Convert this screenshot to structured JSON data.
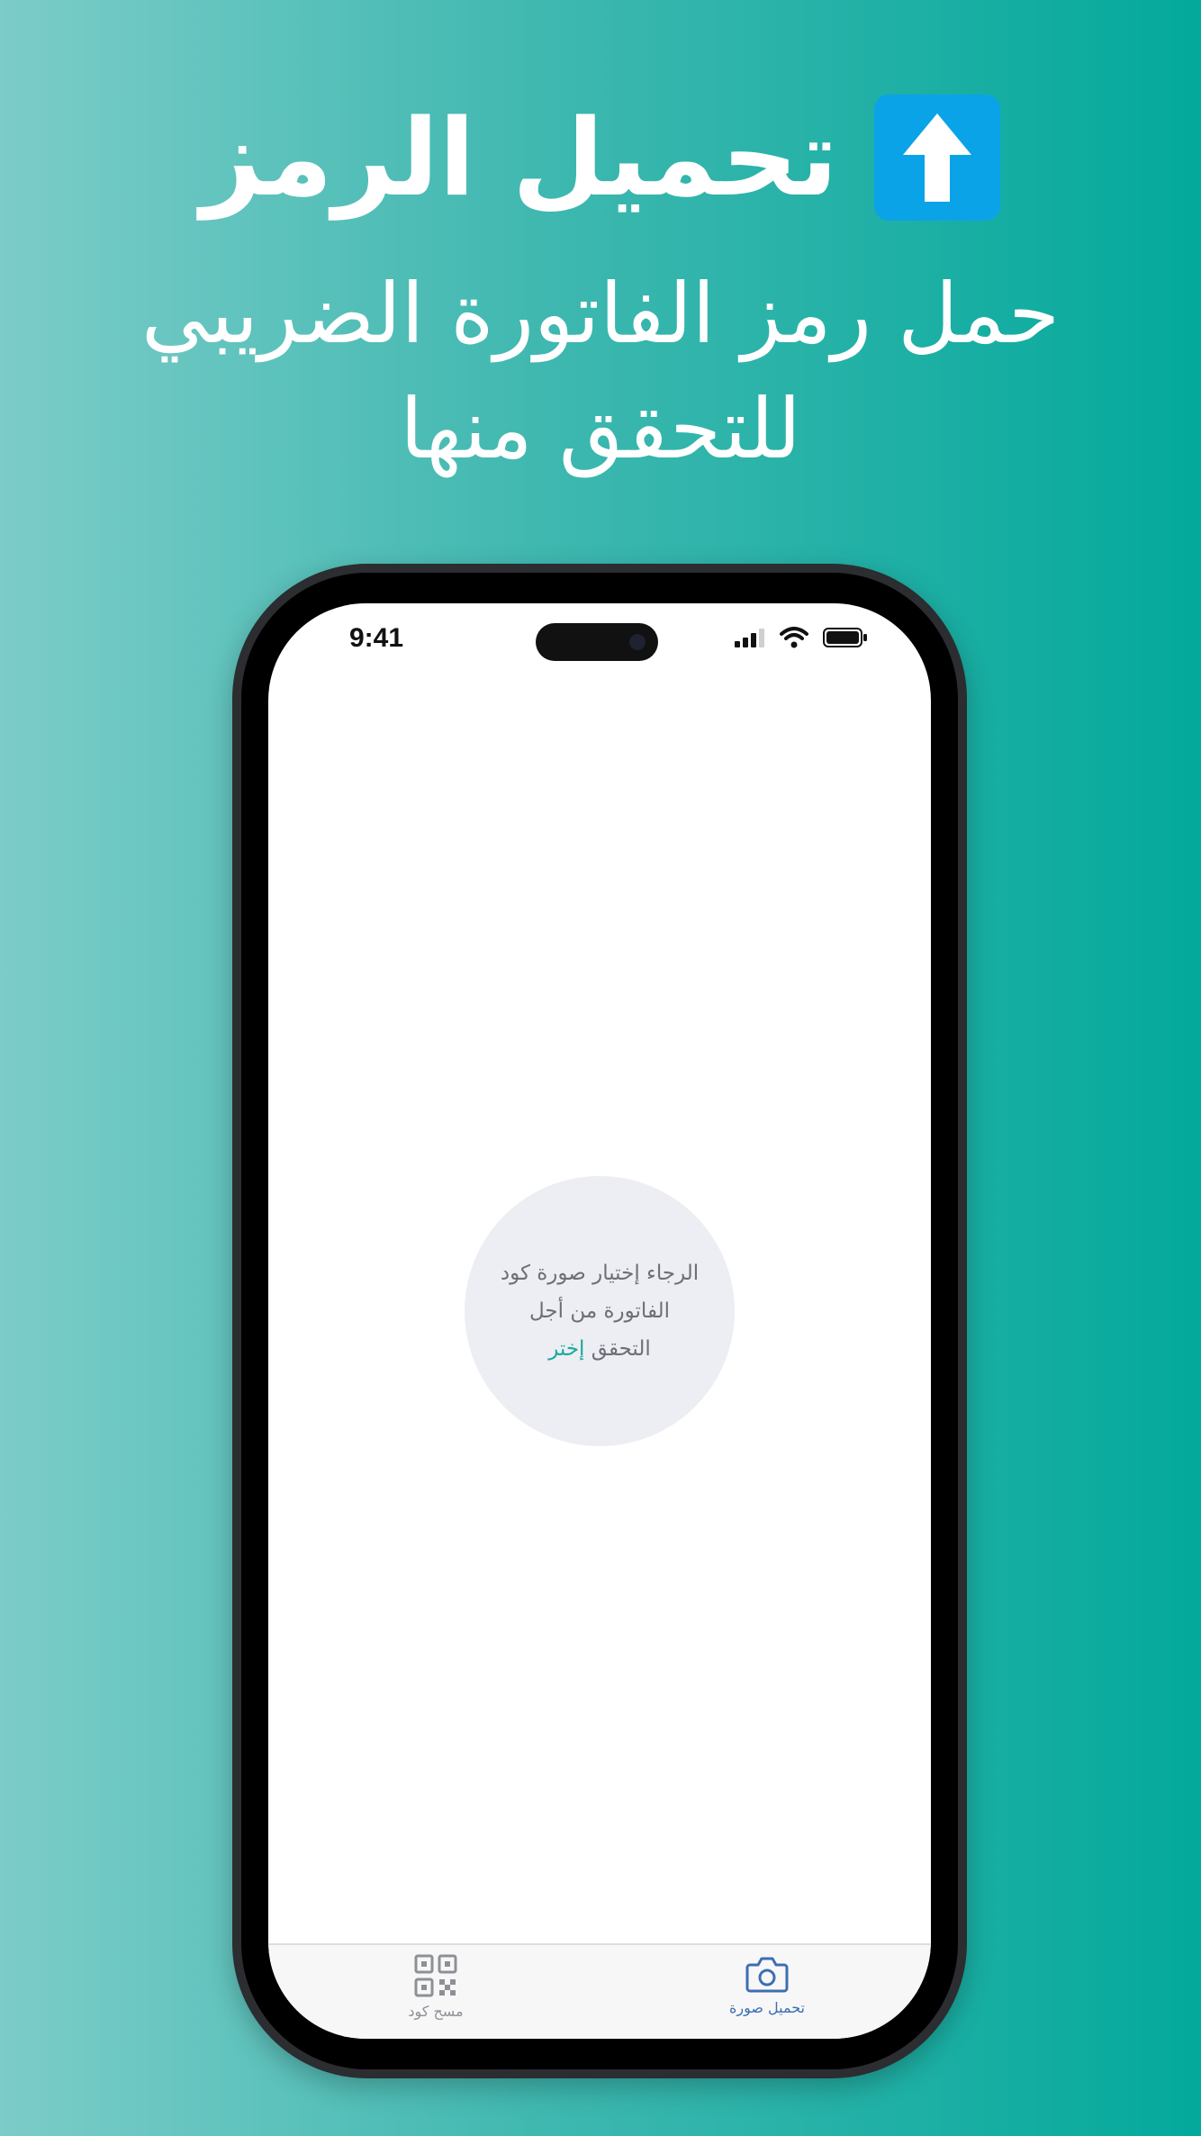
{
  "hero": {
    "title": "تحميل الرمز",
    "subtitle_line1": "حمل رمز الفاتورة الضريبي",
    "subtitle_line2": "للتحقق منها",
    "badge_icon": "upload-arrow-icon",
    "badge_color": "#0aa3e8"
  },
  "status_bar": {
    "time": "9:41",
    "icons": [
      "signal-icon",
      "wifi-icon",
      "battery-icon"
    ]
  },
  "picker": {
    "line1": "الرجاء إختيار صورة كود",
    "line2": "الفاتورة من أجل",
    "line3_text": "التحقق",
    "choose_link": "إختر",
    "accent_color": "#19a99c"
  },
  "tab_bar": {
    "scan_label": "مسح كود",
    "scan_icon": "qr-code-icon",
    "upload_label": "تحميل صورة",
    "upload_icon": "camera-icon",
    "active_tab": "upload"
  }
}
